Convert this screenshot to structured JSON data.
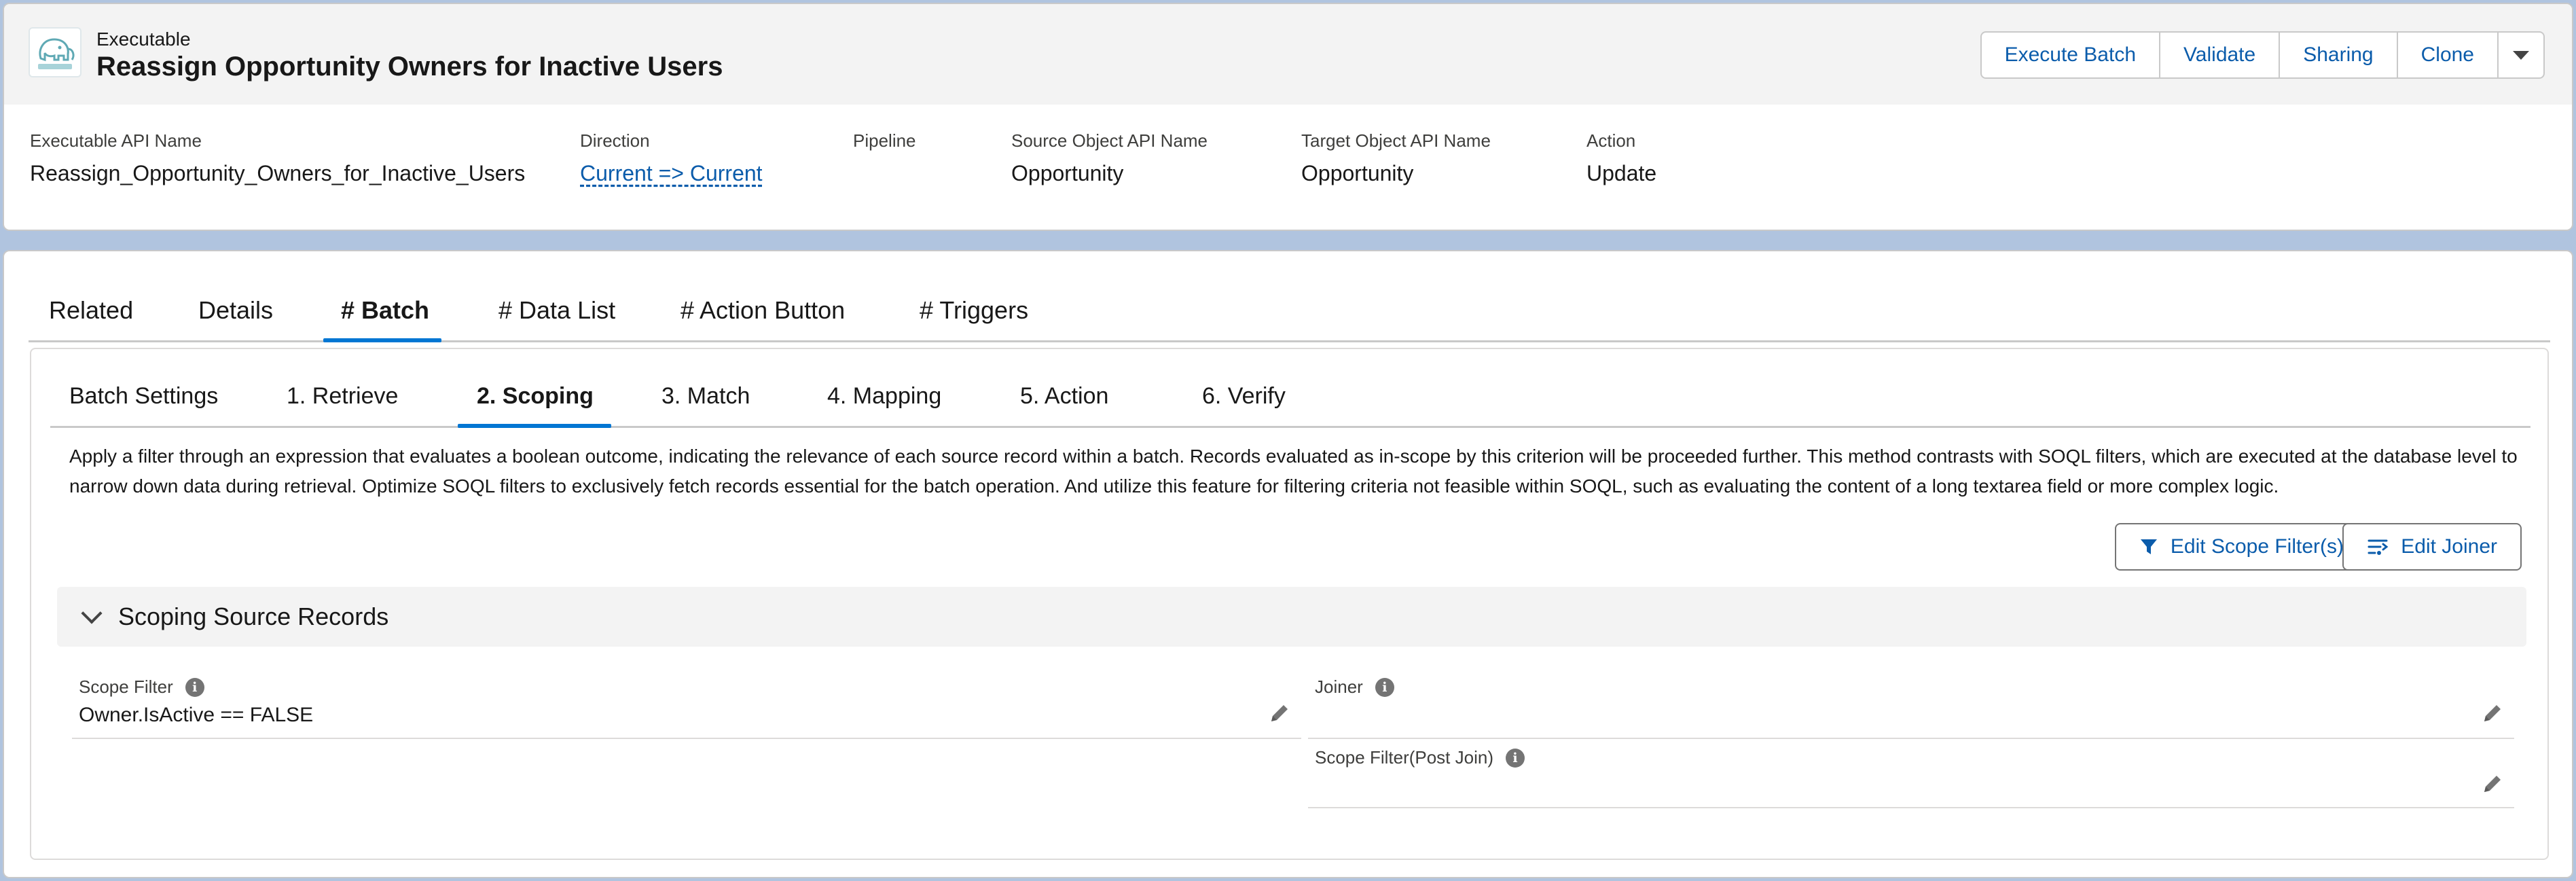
{
  "header": {
    "object_type": "Executable",
    "title": "Reassign Opportunity Owners for Inactive Users",
    "logo_icon": "elephant-logo-icon",
    "buttons": [
      "Execute Batch",
      "Validate",
      "Sharing",
      "Clone"
    ],
    "menu_icon": "chevron-down-icon"
  },
  "highlights": [
    {
      "label": "Executable API Name",
      "value": "Reassign_Opportunity_Owners_for_Inactive_Users"
    },
    {
      "label": "Direction",
      "value": "Current => Current"
    },
    {
      "label": "Pipeline",
      "value": ""
    },
    {
      "label": "Source Object API Name",
      "value": "Opportunity"
    },
    {
      "label": "Target Object API Name",
      "value": "Opportunity"
    },
    {
      "label": "Action",
      "value": "Update"
    }
  ],
  "tabs": [
    "Related",
    "Details",
    "# Batch",
    "# Data List",
    "# Action Button",
    "# Triggers"
  ],
  "active_tab": "# Batch",
  "subtabs": [
    "Batch Settings",
    "1. Retrieve",
    "2. Scoping",
    "3. Match",
    "4. Mapping",
    "5. Action",
    "6. Verify"
  ],
  "active_subtab": "2. Scoping",
  "description": "Apply a filter through an expression that evaluates a boolean outcome, indicating the relevance of each source record within a batch. Records evaluated as in-scope by this criterion will be proceeded further. This method contrasts with SOQL filters, which are executed at the database level to narrow down data during retrieval. Optimize SOQL filters to exclusively fetch records essential for the batch operation. And utilize this feature for filtering criteria not feasible within SOQL, such as evaluating the content of a long textarea field or more complex logic.",
  "actions": {
    "edit_scope_filter": "Edit Scope Filter(s)",
    "edit_joiner": "Edit Joiner"
  },
  "section": {
    "title": "Scoping Source Records",
    "fields": {
      "scope_filter": {
        "label": "Scope Filter",
        "value": "Owner.IsActive == FALSE"
      },
      "joiner": {
        "label": "Joiner",
        "value": ""
      },
      "scope_filter_post_join": {
        "label": "Scope Filter(Post Join)",
        "value": ""
      }
    }
  },
  "colors": {
    "brand_blue": "#0176d3",
    "link_blue": "#0b5cab",
    "background": "#b0c4df"
  }
}
